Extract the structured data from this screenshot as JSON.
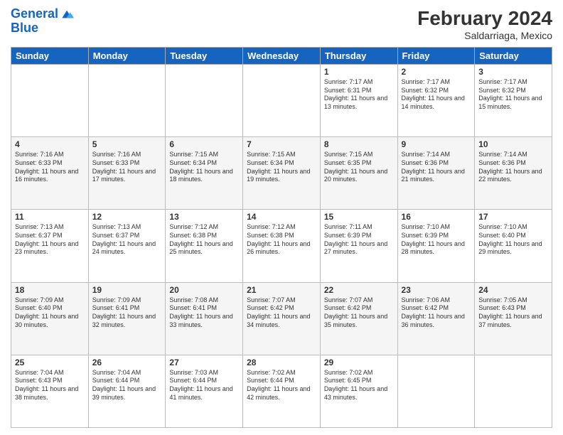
{
  "logo": {
    "line1": "General",
    "line2": "Blue"
  },
  "header": {
    "month_year": "February 2024",
    "location": "Saldarriaga, Mexico"
  },
  "days_of_week": [
    "Sunday",
    "Monday",
    "Tuesday",
    "Wednesday",
    "Thursday",
    "Friday",
    "Saturday"
  ],
  "weeks": [
    [
      {
        "day": "",
        "info": ""
      },
      {
        "day": "",
        "info": ""
      },
      {
        "day": "",
        "info": ""
      },
      {
        "day": "",
        "info": ""
      },
      {
        "day": "1",
        "info": "Sunrise: 7:17 AM\nSunset: 6:31 PM\nDaylight: 11 hours and 13 minutes."
      },
      {
        "day": "2",
        "info": "Sunrise: 7:17 AM\nSunset: 6:32 PM\nDaylight: 11 hours and 14 minutes."
      },
      {
        "day": "3",
        "info": "Sunrise: 7:17 AM\nSunset: 6:32 PM\nDaylight: 11 hours and 15 minutes."
      }
    ],
    [
      {
        "day": "4",
        "info": "Sunrise: 7:16 AM\nSunset: 6:33 PM\nDaylight: 11 hours and 16 minutes."
      },
      {
        "day": "5",
        "info": "Sunrise: 7:16 AM\nSunset: 6:33 PM\nDaylight: 11 hours and 17 minutes."
      },
      {
        "day": "6",
        "info": "Sunrise: 7:15 AM\nSunset: 6:34 PM\nDaylight: 11 hours and 18 minutes."
      },
      {
        "day": "7",
        "info": "Sunrise: 7:15 AM\nSunset: 6:34 PM\nDaylight: 11 hours and 19 minutes."
      },
      {
        "day": "8",
        "info": "Sunrise: 7:15 AM\nSunset: 6:35 PM\nDaylight: 11 hours and 20 minutes."
      },
      {
        "day": "9",
        "info": "Sunrise: 7:14 AM\nSunset: 6:36 PM\nDaylight: 11 hours and 21 minutes."
      },
      {
        "day": "10",
        "info": "Sunrise: 7:14 AM\nSunset: 6:36 PM\nDaylight: 11 hours and 22 minutes."
      }
    ],
    [
      {
        "day": "11",
        "info": "Sunrise: 7:13 AM\nSunset: 6:37 PM\nDaylight: 11 hours and 23 minutes."
      },
      {
        "day": "12",
        "info": "Sunrise: 7:13 AM\nSunset: 6:37 PM\nDaylight: 11 hours and 24 minutes."
      },
      {
        "day": "13",
        "info": "Sunrise: 7:12 AM\nSunset: 6:38 PM\nDaylight: 11 hours and 25 minutes."
      },
      {
        "day": "14",
        "info": "Sunrise: 7:12 AM\nSunset: 6:38 PM\nDaylight: 11 hours and 26 minutes."
      },
      {
        "day": "15",
        "info": "Sunrise: 7:11 AM\nSunset: 6:39 PM\nDaylight: 11 hours and 27 minutes."
      },
      {
        "day": "16",
        "info": "Sunrise: 7:10 AM\nSunset: 6:39 PM\nDaylight: 11 hours and 28 minutes."
      },
      {
        "day": "17",
        "info": "Sunrise: 7:10 AM\nSunset: 6:40 PM\nDaylight: 11 hours and 29 minutes."
      }
    ],
    [
      {
        "day": "18",
        "info": "Sunrise: 7:09 AM\nSunset: 6:40 PM\nDaylight: 11 hours and 30 minutes."
      },
      {
        "day": "19",
        "info": "Sunrise: 7:09 AM\nSunset: 6:41 PM\nDaylight: 11 hours and 32 minutes."
      },
      {
        "day": "20",
        "info": "Sunrise: 7:08 AM\nSunset: 6:41 PM\nDaylight: 11 hours and 33 minutes."
      },
      {
        "day": "21",
        "info": "Sunrise: 7:07 AM\nSunset: 6:42 PM\nDaylight: 11 hours and 34 minutes."
      },
      {
        "day": "22",
        "info": "Sunrise: 7:07 AM\nSunset: 6:42 PM\nDaylight: 11 hours and 35 minutes."
      },
      {
        "day": "23",
        "info": "Sunrise: 7:06 AM\nSunset: 6:42 PM\nDaylight: 11 hours and 36 minutes."
      },
      {
        "day": "24",
        "info": "Sunrise: 7:05 AM\nSunset: 6:43 PM\nDaylight: 11 hours and 37 minutes."
      }
    ],
    [
      {
        "day": "25",
        "info": "Sunrise: 7:04 AM\nSunset: 6:43 PM\nDaylight: 11 hours and 38 minutes."
      },
      {
        "day": "26",
        "info": "Sunrise: 7:04 AM\nSunset: 6:44 PM\nDaylight: 11 hours and 39 minutes."
      },
      {
        "day": "27",
        "info": "Sunrise: 7:03 AM\nSunset: 6:44 PM\nDaylight: 11 hours and 41 minutes."
      },
      {
        "day": "28",
        "info": "Sunrise: 7:02 AM\nSunset: 6:44 PM\nDaylight: 11 hours and 42 minutes."
      },
      {
        "day": "29",
        "info": "Sunrise: 7:02 AM\nSunset: 6:45 PM\nDaylight: 11 hours and 43 minutes."
      },
      {
        "day": "",
        "info": ""
      },
      {
        "day": "",
        "info": ""
      }
    ]
  ]
}
